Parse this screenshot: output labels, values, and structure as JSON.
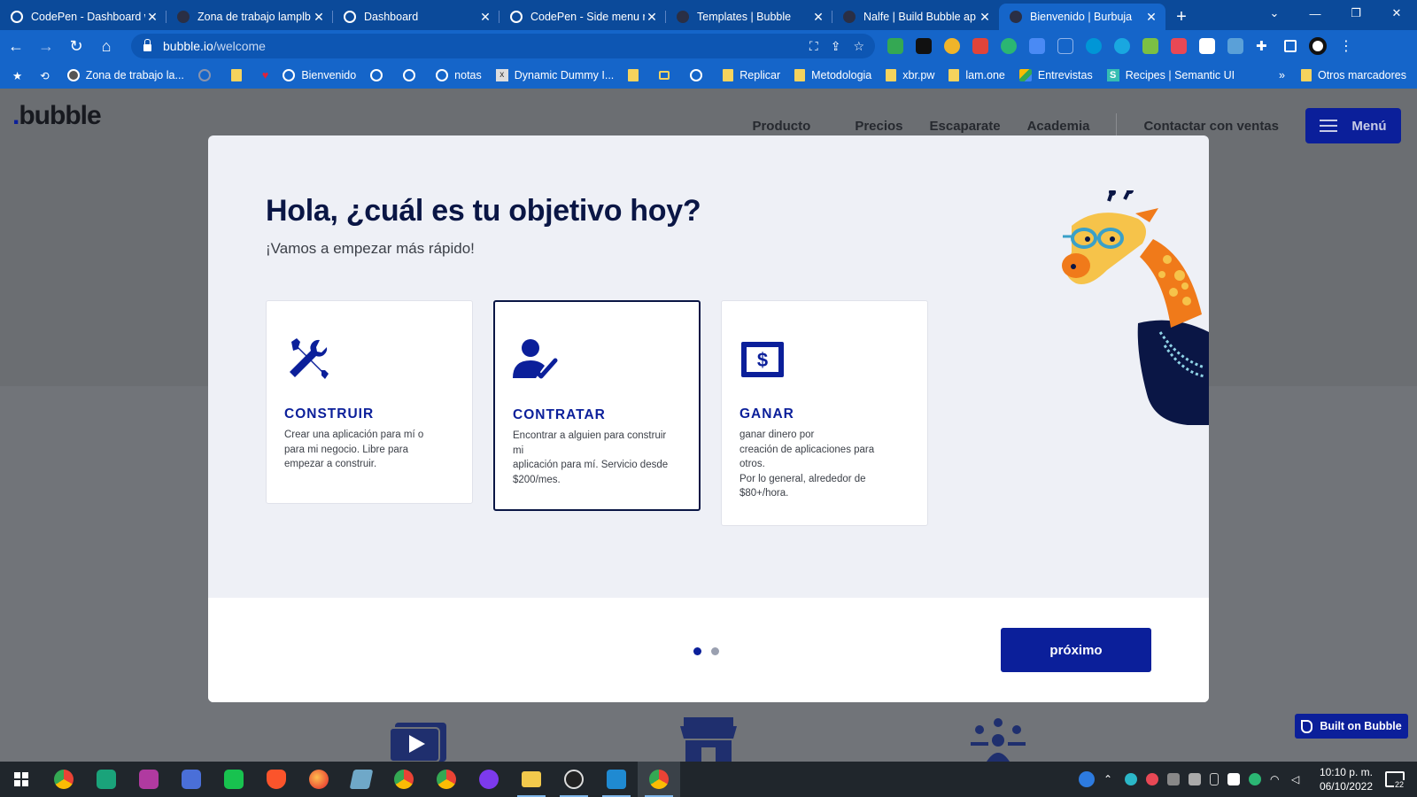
{
  "browser": {
    "tabs": [
      {
        "title": "CodePen - Dashboard w",
        "active": false
      },
      {
        "title": "Zona de trabajo lamplb",
        "active": false
      },
      {
        "title": "Dashboard",
        "active": false
      },
      {
        "title": "CodePen - Side menu re",
        "active": false
      },
      {
        "title": "Templates | Bubble",
        "active": false
      },
      {
        "title": "Nalfe | Build Bubble ap",
        "active": false
      },
      {
        "title": "Bienvenido | Burbuja",
        "active": true
      }
    ],
    "url_host": "bubble.io",
    "url_path": "/welcome",
    "bookmarks": [
      {
        "label": "Zona de trabajo la...",
        "icon": "globe"
      },
      {
        "label": "Bienvenido",
        "icon": "globe"
      },
      {
        "label": "notas",
        "icon": "globe"
      },
      {
        "label": "Dynamic Dummy I...",
        "icon": "x-icon"
      },
      {
        "label": "Replicar",
        "icon": "folder"
      },
      {
        "label": "Metodologia",
        "icon": "folder"
      },
      {
        "label": "xbr.pw",
        "icon": "folder"
      },
      {
        "label": "lam.one",
        "icon": "folder"
      },
      {
        "label": "Entrevistas",
        "icon": "drive"
      },
      {
        "label": "Recipes | Semantic UI",
        "icon": "semantic"
      }
    ],
    "other_bookmarks": "Otros marcadores",
    "chevron": "»"
  },
  "site": {
    "logo": "bubble",
    "nav": [
      "Producto",
      "Precios",
      "Escaparate",
      "Academia"
    ],
    "contact": "Contactar con ventas",
    "menu_label": "Menú",
    "built_on": "Built on Bubble"
  },
  "modal": {
    "title": "Hola, ¿cuál es tu objetivo hoy?",
    "subtitle": "¡Vamos a empezar más rápido!",
    "cards": [
      {
        "title": "CONSTRUIR",
        "desc": "Crear una aplicación para mí o\npara mi negocio. Libre para\nempezar a construir.",
        "icon": "tools-icon",
        "selected": false
      },
      {
        "title": "CONTRATAR",
        "desc": "Encontrar a alguien para construir\nmi\naplicación para mí. Servicio desde\n$200/mes.",
        "icon": "person-check-icon",
        "selected": true
      },
      {
        "title": "GANAR",
        "desc": "ganar dinero por\ncreación de aplicaciones para\notros.\nPor lo general, alrededor de\n$80+/hora.",
        "icon": "dollar-icon",
        "selected": false
      }
    ],
    "page_dots": 2,
    "current_dot": 1,
    "next_label": "próximo"
  },
  "taskbar": {
    "time": "10:10 p. m.",
    "date": "06/10/2022",
    "notifications": "22"
  }
}
